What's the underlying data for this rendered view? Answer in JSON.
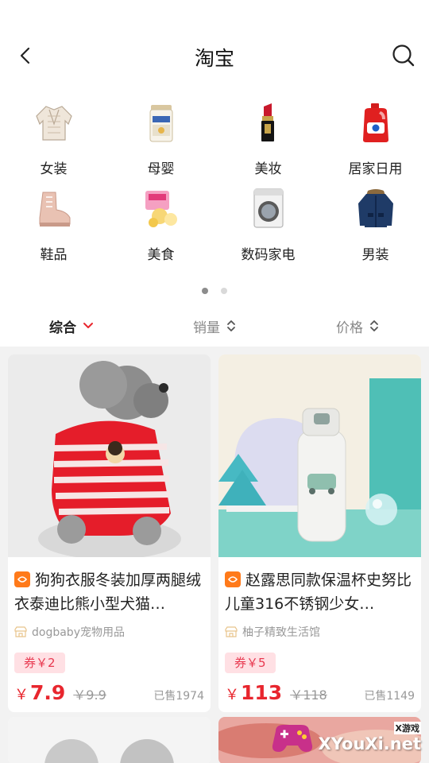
{
  "header": {
    "title": "淘宝"
  },
  "categories": [
    {
      "label": "女装",
      "icon": "womens-coat-icon"
    },
    {
      "label": "母婴",
      "icon": "formula-can-icon"
    },
    {
      "label": "美妆",
      "icon": "lipstick-icon"
    },
    {
      "label": "居家日用",
      "icon": "detergent-icon"
    },
    {
      "label": "鞋品",
      "icon": "boot-icon"
    },
    {
      "label": "美食",
      "icon": "snack-icon"
    },
    {
      "label": "数码家电",
      "icon": "washing-machine-icon"
    },
    {
      "label": "男装",
      "icon": "mens-jacket-icon"
    }
  ],
  "pager": {
    "pages": 2,
    "active": 0
  },
  "sort": [
    {
      "label": "综合",
      "active": true
    },
    {
      "label": "销量",
      "active": false
    },
    {
      "label": "价格",
      "active": false
    }
  ],
  "products": [
    {
      "title": "狗狗衣服冬装加厚两腿绒衣泰迪比熊小型犬猫…",
      "shop": "dogbaby宠物用品",
      "coupon": "券￥2",
      "price_symbol": "￥",
      "price": "7.9",
      "original_price": "￥9.9",
      "sold": "已售1974"
    },
    {
      "title": "赵露思同款保温杯史努比儿童316不锈钢少女…",
      "shop": "柚子精致生活馆",
      "coupon": "券￥5",
      "price_symbol": "￥",
      "price": "113",
      "original_price": "￥118",
      "sold": "已售1149"
    }
  ],
  "watermark": {
    "small": "X游戏",
    "text": "XYouXi.net"
  },
  "colors": {
    "accent": "#e8262e",
    "coupon_bg": "#ffe0e4",
    "feed_bg": "#f2f2f2",
    "badge": "#ff7a1a"
  }
}
